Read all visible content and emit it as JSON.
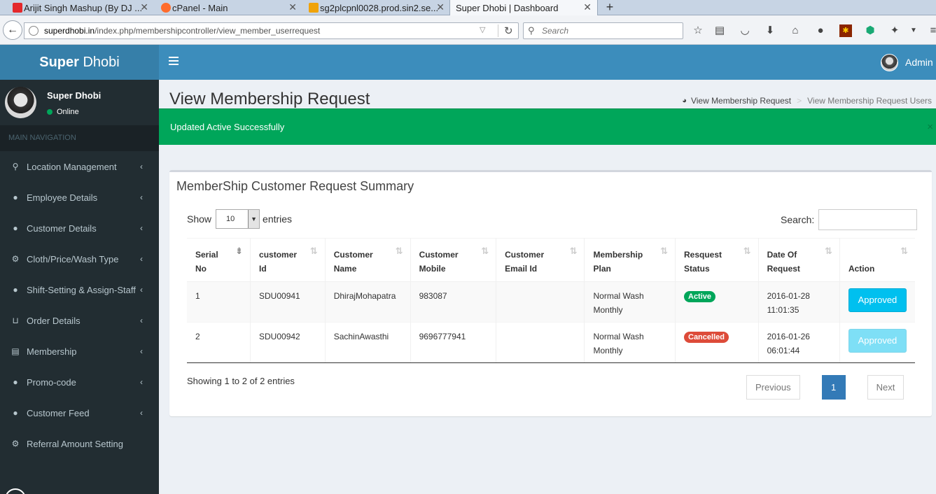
{
  "browser": {
    "tabs": [
      {
        "title": "Arijit Singh Mashup (By DJ ...",
        "favicon_color": "#e4282b"
      },
      {
        "title": "cPanel - Main",
        "favicon_color": "#ff6c2c"
      },
      {
        "title": "sg2plcpnl0028.prod.sin2.se...",
        "favicon_color": "#f0a30a"
      },
      {
        "title": "Super Dhobi | Dashboard",
        "favicon_color": ""
      }
    ],
    "url_domain": "superdhobi.in",
    "url_path": "/index.php/membershipcontroller/view_member_userrequest",
    "search_placeholder": "Search",
    "toolbar_icons": [
      "star-icon",
      "reading-list-icon",
      "pocket-icon",
      "download-icon",
      "home-icon",
      "chat-icon",
      "addon-icon",
      "shield-addon-icon",
      "puzzle-icon",
      "menu-dropdown-icon"
    ]
  },
  "app": {
    "logo_bold": "Super",
    "logo_light": "Dhobi",
    "admin_name": "Admin"
  },
  "sidebar": {
    "user_name": "Super Dhobi",
    "status": "Online",
    "nav_header": "MAIN NAVIGATION",
    "items": [
      {
        "label": "Location Management",
        "icon": "map-marker-icon",
        "glyph": "⚲"
      },
      {
        "label": "Employee Details",
        "icon": "user-icon",
        "glyph": "●"
      },
      {
        "label": "Customer Details",
        "icon": "users-icon",
        "glyph": "●"
      },
      {
        "label": "Cloth/Price/Wash Type",
        "icon": "cogs-icon",
        "glyph": "⚙"
      },
      {
        "label": "Shift-Setting & Assign-Staff",
        "icon": "user-plus-icon",
        "glyph": "●"
      },
      {
        "label": "Order Details",
        "icon": "cart-icon",
        "glyph": "⊔"
      },
      {
        "label": "Membership",
        "icon": "list-icon",
        "glyph": "▤"
      },
      {
        "label": "Promo-code",
        "icon": "users-icon",
        "glyph": "●"
      },
      {
        "label": "Customer Feed",
        "icon": "users-icon",
        "glyph": "●"
      },
      {
        "label": "Referral Amount Setting",
        "icon": "gear-icon",
        "glyph": "⚙"
      }
    ]
  },
  "content": {
    "page_title": "View Membership Request",
    "breadcrumb": [
      "View Membership Request",
      "View Membership Request Users"
    ],
    "alert": "Updated Active Successfully",
    "box_title": "MemberShip Customer Request Summary",
    "show_label": "Show",
    "entries_value": "10",
    "entries_label": "entries",
    "search_label": "Search:",
    "columns": [
      {
        "line1": "Serial",
        "line2": "No"
      },
      {
        "line1": "customer",
        "line2": "Id"
      },
      {
        "line1": "Customer",
        "line2": "Name"
      },
      {
        "line1": "Customer",
        "line2": "Mobile"
      },
      {
        "line1": "Customer",
        "line2": "Email Id"
      },
      {
        "line1": "Membership",
        "line2": "Plan"
      },
      {
        "line1": "Resquest",
        "line2": "Status"
      },
      {
        "line1": "Date Of",
        "line2": "Request"
      },
      {
        "line1": "",
        "line2": "Action"
      }
    ],
    "rows": [
      {
        "serial": "1",
        "customer_id": "SDU00941",
        "name": "DhirajMohapatra",
        "mobile": "983087",
        "email": "",
        "plan_line1": "Normal Wash",
        "plan_line2": "Monthly",
        "status": "Active",
        "status_color": "#00a65a",
        "date": "2016-01-28",
        "time": "11:01:35",
        "action": "Approved",
        "action_disabled": false
      },
      {
        "serial": "2",
        "customer_id": "SDU00942",
        "name": "SachinAwasthi",
        "mobile": "9696777941",
        "email": "",
        "plan_line1": "Normal Wash",
        "plan_line2": "Monthly",
        "status": "Cancelled",
        "status_color": "#dd4b39",
        "date": "2016-01-26",
        "time": "06:01:44",
        "action": "Approved",
        "action_disabled": true
      }
    ],
    "info": "Showing 1 to 2 of 2 entries",
    "pagination": {
      "previous": "Previous",
      "current": "1",
      "next": "Next"
    }
  }
}
